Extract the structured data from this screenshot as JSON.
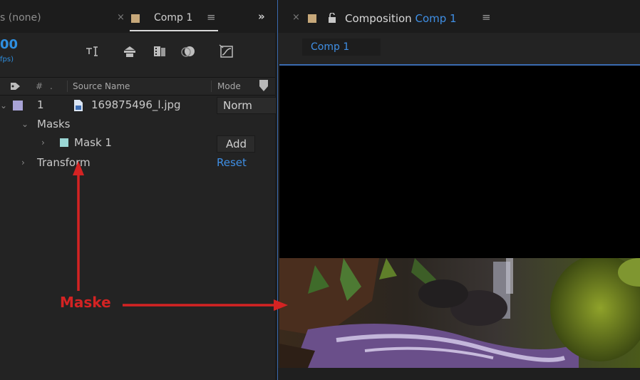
{
  "left_panel": {
    "prev_tab_label": "s (none)",
    "close_glyph": "×",
    "comp_tab_label": "Comp 1",
    "menu_glyph": "≡",
    "overflow_glyph": "»",
    "timecode": "00",
    "timecode_sub": "fps)",
    "toolbar_icons": [
      "comp-flowchart-icon",
      "draft-3d-icon",
      "frame-blending-icon",
      "motion-blur-icon",
      "graph-editor-icon"
    ],
    "header": {
      "hash": "#",
      "dot": ".",
      "source_name": "Source Name",
      "mode": "Mode"
    },
    "layer": {
      "number": "1",
      "name": "169875496_l.jpg",
      "mode": "Norm"
    },
    "masks_label": "Masks",
    "mask_label": "Mask 1",
    "mask_mode": "Add",
    "transform_label": "Transform",
    "reset_label": "Reset",
    "colors": {
      "layer_label": "#a8a3d6",
      "mask_label": "#9bd7d5",
      "comp_swatch": "#c7a87a",
      "accent": "#3f8fe5"
    }
  },
  "right_panel": {
    "close_glyph": "×",
    "title_prefix": "Composition",
    "title_comp": "Comp 1",
    "menu_glyph": "≡",
    "breadcrumb": "Comp 1",
    "viewer_content": "waterfall image masked to lower strip"
  },
  "annotation": {
    "label": "Maske",
    "color": "#d42323"
  }
}
